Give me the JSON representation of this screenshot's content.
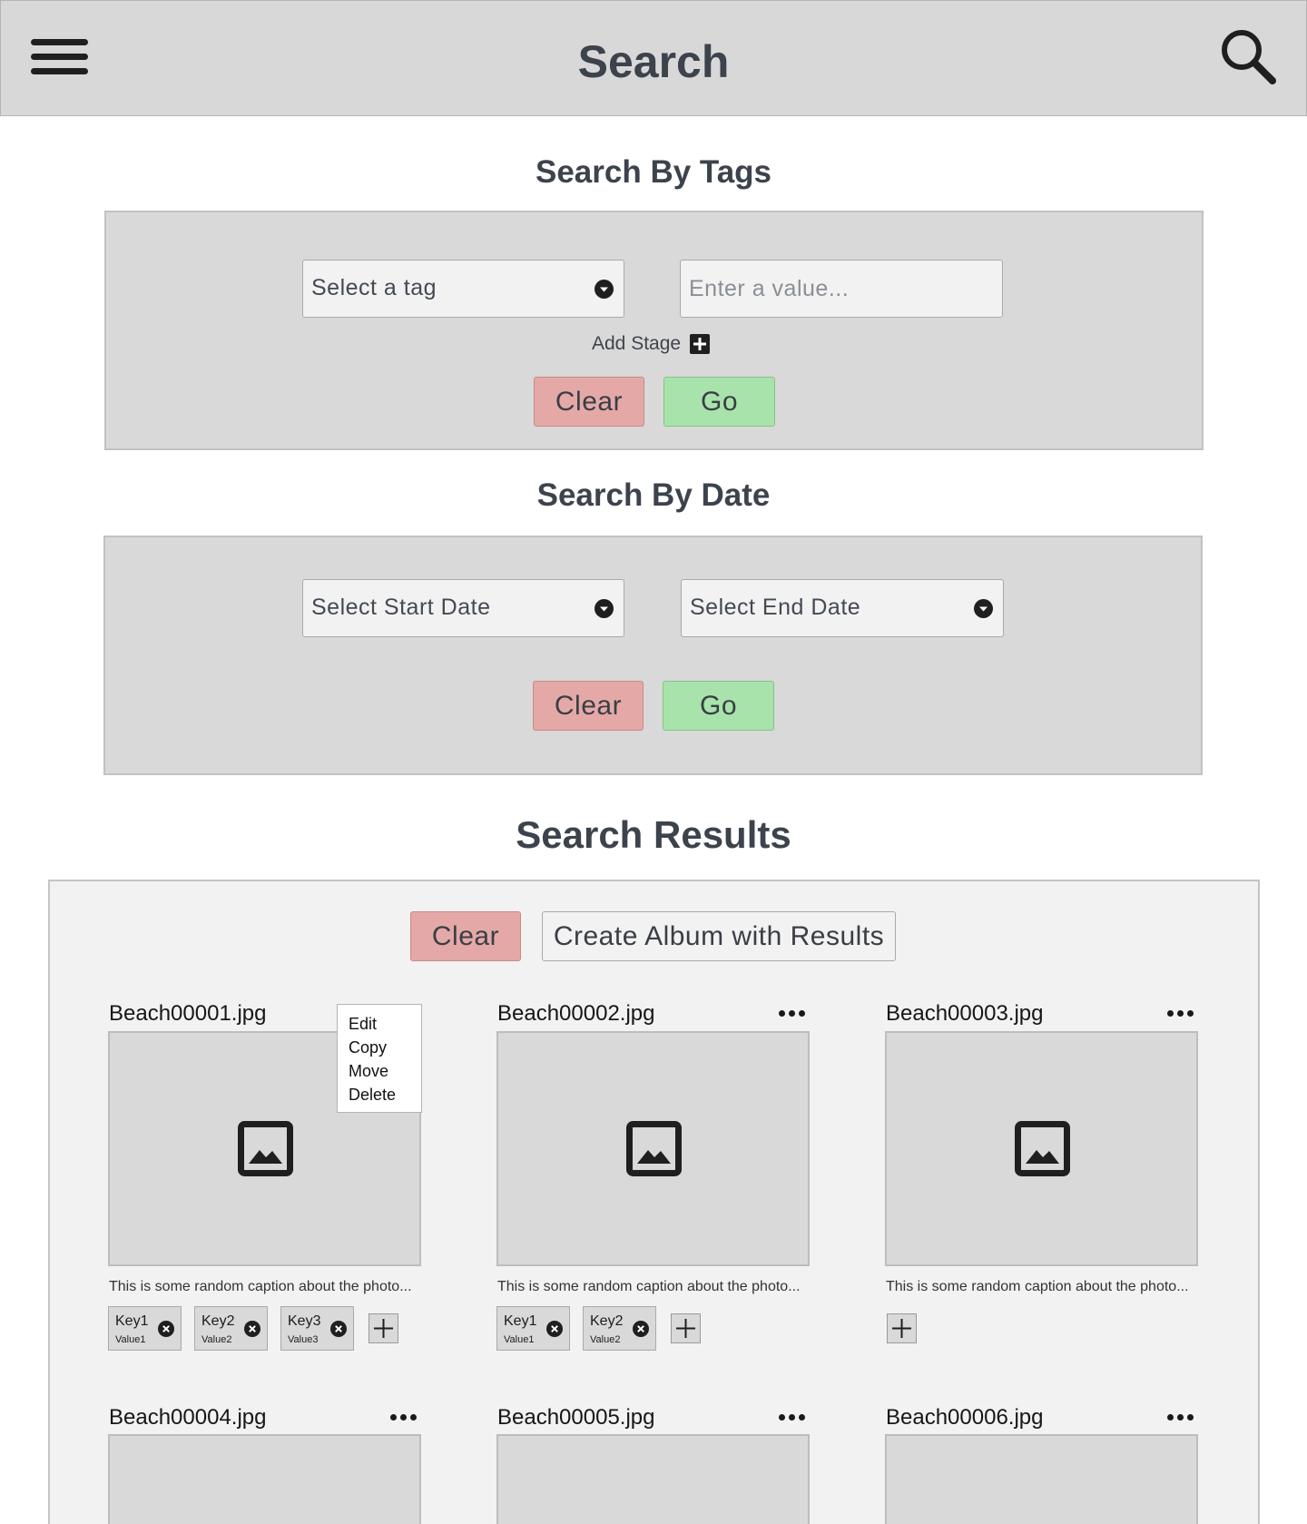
{
  "header": {
    "title": "Search",
    "menu_icon": "hamburger-menu-icon",
    "search_icon": "search-icon"
  },
  "tags_section": {
    "heading": "Search By Tags",
    "tag_select": {
      "value": "Select a tag"
    },
    "value_input": {
      "placeholder": "Enter a value..."
    },
    "add_stage_label": "Add Stage",
    "clear_label": "Clear",
    "go_label": "Go"
  },
  "date_section": {
    "heading": "Search By Date",
    "start_select": {
      "value": "Select Start Date"
    },
    "end_select": {
      "value": "Select End Date"
    },
    "clear_label": "Clear",
    "go_label": "Go"
  },
  "results_section": {
    "heading": "Search Results",
    "clear_label": "Clear",
    "create_album_label": "Create Album with Results",
    "context_menu": [
      "Edit",
      "Copy",
      "Move",
      "Delete"
    ],
    "cards": [
      {
        "name": "Beach00001.jpg",
        "caption": "This is some random caption about the photo...",
        "tags": [
          {
            "key": "Key1",
            "value": "Value1"
          },
          {
            "key": "Key2",
            "value": "Value2"
          },
          {
            "key": "Key3",
            "value": "Value3"
          }
        ]
      },
      {
        "name": "Beach00002.jpg",
        "caption": "This is some random caption about the photo...",
        "tags": [
          {
            "key": "Key1",
            "value": "Value1"
          },
          {
            "key": "Key2",
            "value": "Value2"
          }
        ]
      },
      {
        "name": "Beach00003.jpg",
        "caption": "This is some random caption about the photo...",
        "tags": []
      },
      {
        "name": "Beach00004.jpg"
      },
      {
        "name": "Beach00005.jpg"
      },
      {
        "name": "Beach00006.jpg"
      }
    ]
  },
  "colors": {
    "topbar": "#d8d8d8",
    "panel": "#d9d9d9",
    "clear_button": "#e4a9a7",
    "go_button": "#a8e3ab",
    "results_background": "#f2f2f2",
    "heading_text": "#3d434c"
  }
}
